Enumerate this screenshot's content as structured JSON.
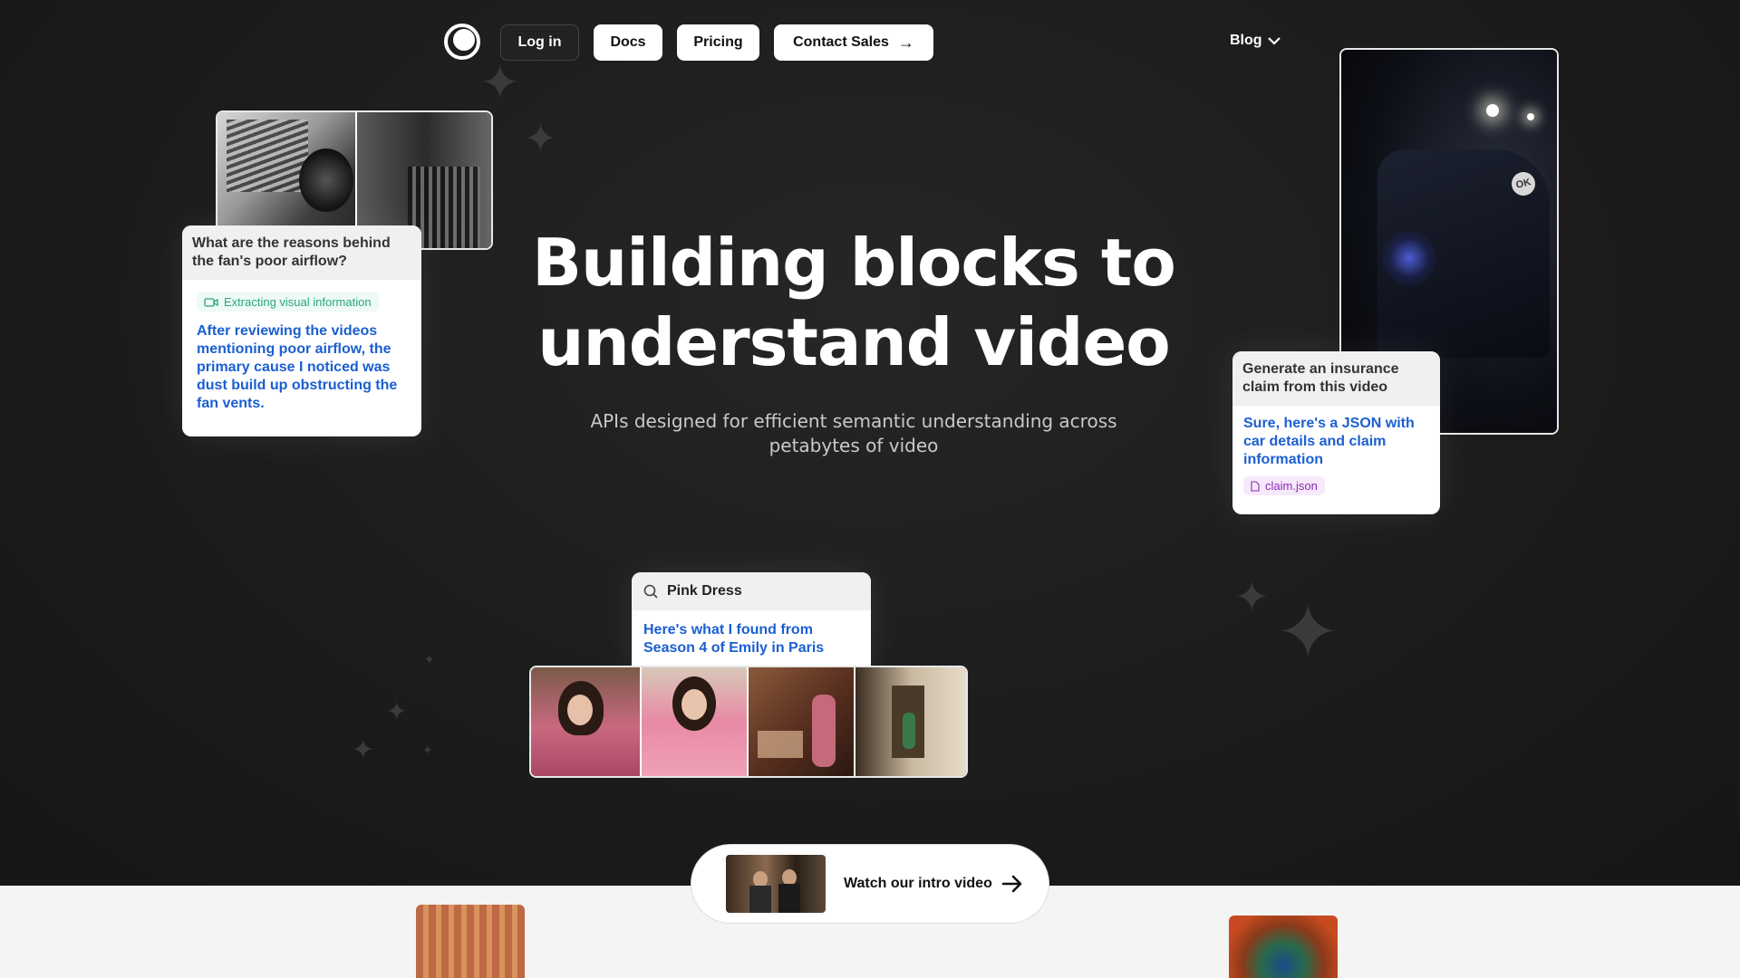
{
  "nav": {
    "login": "Log in",
    "docs": "Docs",
    "pricing": "Pricing",
    "contact": "Contact Sales",
    "blog": "Blog"
  },
  "hero": {
    "title_line1": "Building blocks to",
    "title_line2": "understand video",
    "subtitle_line1": "APIs designed for efficient semantic understanding across",
    "subtitle_line2": "petabytes of video"
  },
  "card_fan": {
    "question": "What are the reasons behind the fan's poor airflow?",
    "status": "Extracting visual information",
    "answer": "After reviewing the videos mentioning poor airflow, the primary cause I noticed was dust build up obstructing the fan vents."
  },
  "card_insurance": {
    "question": "Generate an insurance claim from this video",
    "answer": "Sure, here's a JSON with car details and claim information",
    "file": "claim.json",
    "car_badge": "OK"
  },
  "card_search": {
    "query": "Pink Dress",
    "answer": "Here's what I found from Season 4 of Emily in Paris"
  },
  "cta": {
    "watch": "Watch our intro video"
  },
  "colors": {
    "background": "#1a1a1a",
    "answer_blue": "#1b5fd1",
    "status_green": "#2aa87a",
    "file_purple": "#8b2bb0",
    "bottom_band": "#f4f4f3"
  },
  "icons": [
    "logo-icon",
    "arrow-right-icon",
    "chevron-down-icon",
    "video-icon",
    "file-icon",
    "search-icon",
    "sparkle-icon"
  ]
}
